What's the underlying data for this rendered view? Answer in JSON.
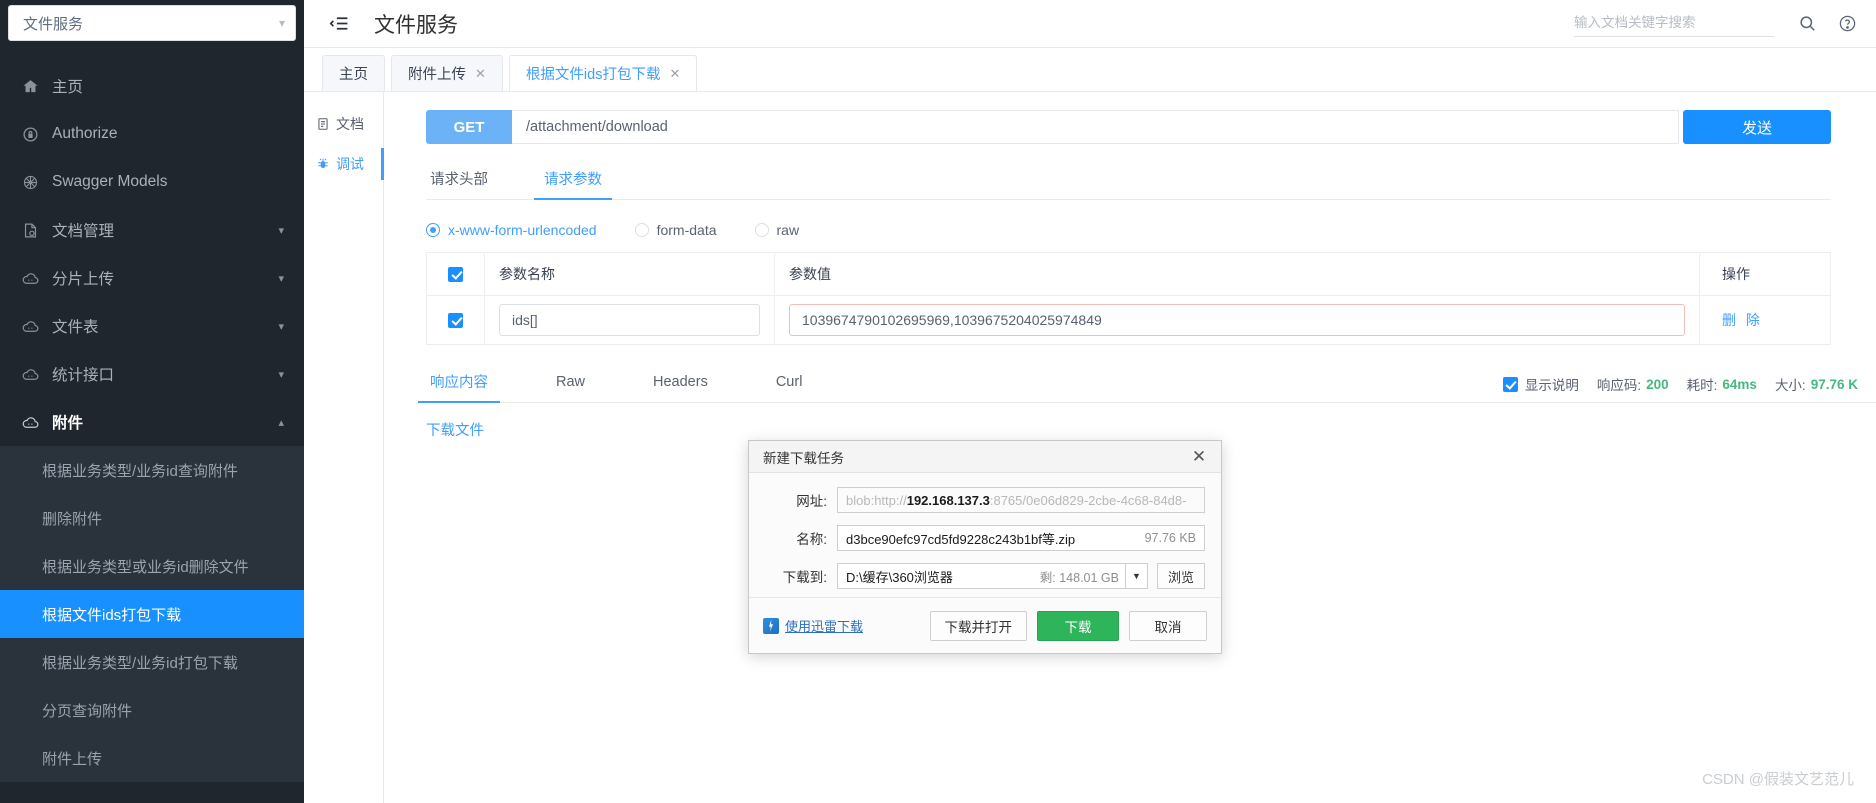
{
  "sidebar": {
    "project_select": {
      "value": "文件服务",
      "icon": "chevron-down-icon"
    },
    "items": [
      {
        "label": "主页",
        "icon": "home-icon",
        "expandable": false
      },
      {
        "label": "Authorize",
        "icon": "lock-icon",
        "expandable": false
      },
      {
        "label": "Swagger Models",
        "icon": "model-icon",
        "expandable": false
      },
      {
        "label": "文档管理",
        "icon": "doc-icon",
        "expandable": true
      },
      {
        "label": "分片上传",
        "icon": "cloud-icon",
        "expandable": true
      },
      {
        "label": "文件表",
        "icon": "cloud-icon",
        "expandable": true
      },
      {
        "label": "统计接口",
        "icon": "cloud-icon",
        "expandable": true
      },
      {
        "label": "附件",
        "icon": "cloud-icon",
        "expandable": true,
        "expanded": true
      }
    ],
    "sub_items": [
      {
        "label": "根据业务类型/业务id查询附件",
        "active": false
      },
      {
        "label": "删除附件",
        "active": false
      },
      {
        "label": "根据业务类型或业务id删除文件",
        "active": false
      },
      {
        "label": "根据文件ids打包下载",
        "active": true
      },
      {
        "label": "根据业务类型/业务id打包下载",
        "active": false
      },
      {
        "label": "分页查询附件",
        "active": false
      },
      {
        "label": "附件上传",
        "active": false
      }
    ]
  },
  "topbar": {
    "collapse_icon": "menu-collapse-icon",
    "title": "文件服务",
    "search_placeholder": "输入文档关键字搜索",
    "search_value": "",
    "search_icon": "search-icon",
    "help_icon": "help-circle-icon"
  },
  "tabs": [
    {
      "label": "主页",
      "closable": false,
      "active": false
    },
    {
      "label": "附件上传",
      "closable": true,
      "active": false
    },
    {
      "label": "根据文件ids打包下载",
      "closable": true,
      "active": true
    }
  ],
  "doc_nav": [
    {
      "label": "文档",
      "icon": "document-icon",
      "active": false
    },
    {
      "label": "调试",
      "icon": "bug-icon",
      "active": true
    }
  ],
  "request": {
    "method": "GET",
    "url": "/attachment/download",
    "send_label": "发送",
    "tabs": [
      {
        "label": "请求头部",
        "active": false
      },
      {
        "label": "请求参数",
        "active": true
      }
    ],
    "body_types": [
      {
        "label": "x-www-form-urlencoded",
        "selected": true
      },
      {
        "label": "form-data",
        "selected": false
      },
      {
        "label": "raw",
        "selected": false
      }
    ],
    "table": {
      "headers": {
        "name": "参数名称",
        "value": "参数值",
        "op": "操作"
      },
      "rows": [
        {
          "checked": true,
          "name": "ids[]",
          "value": "1039674790102695969,1039675204025974849",
          "value_warn": true,
          "op": "删 除"
        }
      ]
    }
  },
  "response": {
    "tabs": [
      {
        "label": "响应内容",
        "active": true
      },
      {
        "label": "Raw",
        "active": false
      },
      {
        "label": "Headers",
        "active": false
      },
      {
        "label": "Curl",
        "active": false
      }
    ],
    "show_desc_label": "显示说明",
    "show_desc_checked": true,
    "status_key": "响应码:",
    "status_value": "200",
    "time_key": "耗时:",
    "time_value": "64ms",
    "size_key": "大小:",
    "size_value": "97.76 K",
    "download_link": "下载文件"
  },
  "dialog": {
    "title": "新建下载任务",
    "close_icon": "close-icon",
    "url_label": "网址:",
    "url_prefix": "blob:http://",
    "url_host": "192.168.137.3",
    "url_suffix": ":8765/0e06d829-2cbe-4c68-84d8-",
    "name_label": "名称:",
    "name_value": "d3bce90efc97cd5fd9228c243b1bf等.zip",
    "name_size": "97.76 KB",
    "path_label": "下载到:",
    "path_value": "D:\\缓存\\360浏览器",
    "path_free": "剩: 148.01 GB",
    "dropdown_icon": "chevron-down-icon",
    "browse_label": "浏览",
    "thunder_label": "使用迅雷下载",
    "thunder_icon": "thunder-icon",
    "buttons": [
      {
        "label": "下载并打开",
        "primary": false
      },
      {
        "label": "下载",
        "primary": true
      },
      {
        "label": "取消",
        "primary": false
      }
    ]
  },
  "watermark": "CSDN @假装文艺范儿",
  "colors": {
    "sidebar_bg": "#20262e",
    "subnav_bg": "#2a323c",
    "accent": "#1890ff",
    "link": "#409eff",
    "success": "#46b881",
    "dialog_primary": "#2eb55c"
  }
}
